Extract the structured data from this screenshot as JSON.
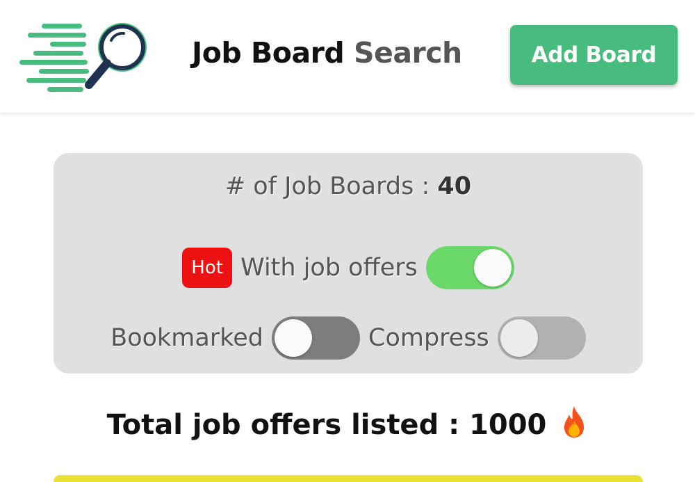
{
  "header": {
    "brand_primary": "Job Board",
    "brand_secondary": "Search",
    "add_button_label": "Add Board",
    "logo_icon": "magnifier-speed-lines-icon"
  },
  "filters": {
    "count_label": "# of Job Boards :",
    "count_value": "40",
    "hot_badge": "Hot",
    "with_offers_label": "With job offers",
    "with_offers_on": true,
    "bookmarked_label": "Bookmarked",
    "bookmarked_on": false,
    "compress_label": "Compress",
    "compress_on": false
  },
  "summary": {
    "total_label": "Total job offers listed :",
    "total_value": "1000",
    "icon": "fire-icon"
  },
  "colors": {
    "brand_green": "#48bb7e",
    "toggle_on": "#6ad96a",
    "hot_red": "#ee1111",
    "panel_bg": "#e0e0e0",
    "accent_yellow": "#e8e033"
  }
}
